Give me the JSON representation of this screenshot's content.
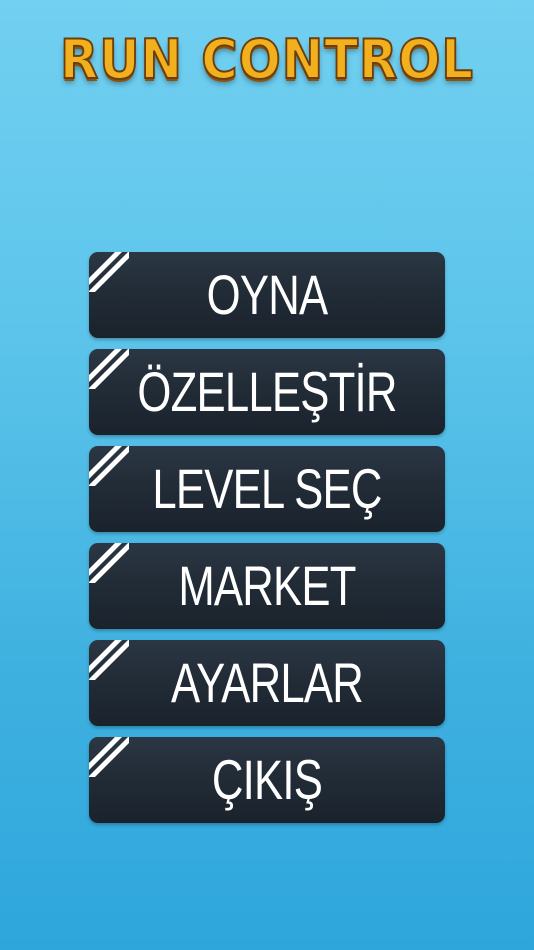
{
  "title": "RUN CONTROL",
  "menu": {
    "items": [
      {
        "label": "OYNA"
      },
      {
        "label": "ÖZELLEŞTİR"
      },
      {
        "label": "LEVEL SEÇ"
      },
      {
        "label": "MARKET"
      },
      {
        "label": "AYARLAR"
      },
      {
        "label": "ÇIKIŞ"
      }
    ]
  },
  "colors": {
    "background_top": "#72d0f1",
    "background_bottom": "#2ea6dc",
    "button": "#222c37",
    "title_fill": "#f2b01e",
    "title_outline": "#6b3e0c"
  },
  "icons": {
    "button_corner": "diagonal-stripes-icon"
  }
}
